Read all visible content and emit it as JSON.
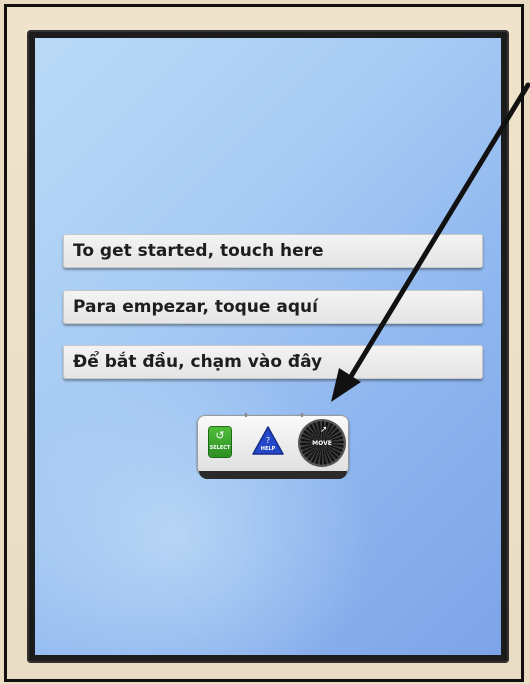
{
  "welcome": {
    "buttons": [
      {
        "label": "To get started, touch here"
      },
      {
        "label": "Para empezar, toque aquí"
      },
      {
        "label": "Để bắt đầu, chạm vào đây"
      }
    ]
  },
  "keypad": {
    "select_label": "SELECT",
    "help_label": "HELP",
    "move_label": "MOVE",
    "select_color": "#2f9a26",
    "help_color": "#2446c8"
  },
  "icons": {
    "select": "select-icon",
    "help": "help-triangle-icon",
    "move": "move-dial-icon",
    "arrow": "pointer-arrow-icon"
  }
}
